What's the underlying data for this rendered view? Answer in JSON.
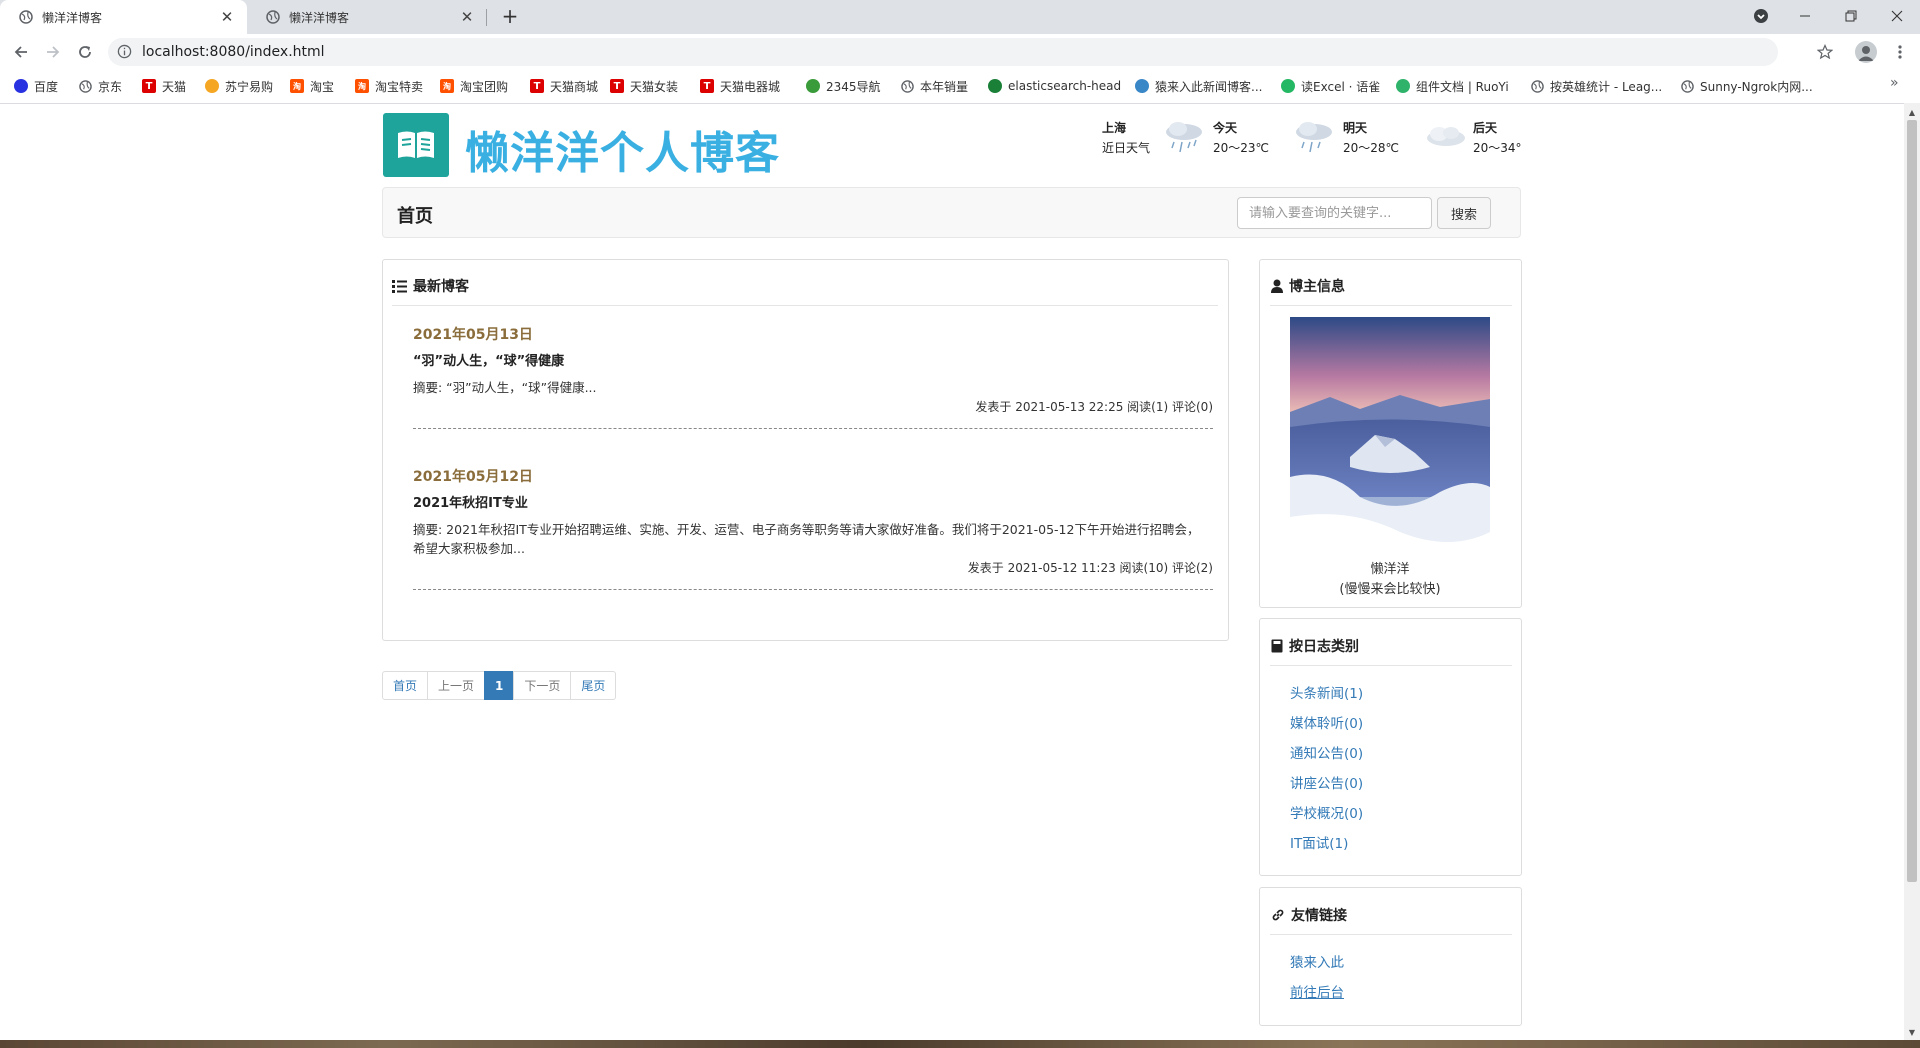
{
  "browser": {
    "tabs": [
      {
        "title": "懒洋洋博客",
        "active": true
      },
      {
        "title": "懒洋洋博客",
        "active": false
      }
    ],
    "close_glyph": "✕",
    "new_tab_glyph": "+",
    "url": "localhost:8080/index.html",
    "bookmarks": [
      {
        "label": "百度",
        "icon": "baidu-paw-icon",
        "color": "#2932e1"
      },
      {
        "label": "京东",
        "icon": "globe-icon",
        "color": "#5f6368"
      },
      {
        "label": "天猫",
        "icon": "tmall-icon",
        "color": "#d00"
      },
      {
        "label": "苏宁易购",
        "icon": "suning-icon",
        "color": "#f5a623"
      },
      {
        "label": "淘宝",
        "icon": "taobao-icon",
        "color": "#ff5000"
      },
      {
        "label": "淘宝特卖",
        "icon": "taobao-icon",
        "color": "#ff5000"
      },
      {
        "label": "淘宝团购",
        "icon": "taobao-icon",
        "color": "#ff5000"
      },
      {
        "label": "天猫商城",
        "icon": "tmall-icon",
        "color": "#d00"
      },
      {
        "label": "天猫女装",
        "icon": "tmall-icon",
        "color": "#d00"
      },
      {
        "label": "天猫电器城",
        "icon": "tmall-icon",
        "color": "#d00"
      },
      {
        "label": "2345导航",
        "icon": "2345-icon",
        "color": "#3a9b3a"
      },
      {
        "label": "本年销量",
        "icon": "globe-icon",
        "color": "#5f6368"
      },
      {
        "label": "elasticsearch-head",
        "icon": "elastic-icon",
        "color": "#1a7f37"
      },
      {
        "label": "猿来入此新闻博客...",
        "icon": "yuan-icon",
        "color": "#3a87c8"
      },
      {
        "label": "读Excel · 语雀",
        "icon": "yuque-icon",
        "color": "#25b864"
      },
      {
        "label": "组件文档 | RuoYi",
        "icon": "ruoyi-icon",
        "color": "#2fb36b"
      },
      {
        "label": "按英雄统计 - Leag...",
        "icon": "globe-icon",
        "color": "#5f6368"
      },
      {
        "label": "Sunny-Ngrok内网...",
        "icon": "globe-icon",
        "color": "#5f6368"
      }
    ],
    "more_glyph": "»"
  },
  "header": {
    "logo_title": "懒洋洋个人博客"
  },
  "weather": {
    "city": "上海",
    "subtitle": "近日天气",
    "days": [
      {
        "label": "今天",
        "temp": "20～23℃",
        "icon": "rain-cloud-icon"
      },
      {
        "label": "明天",
        "temp": "20～28℃",
        "icon": "rain-cloud-icon"
      },
      {
        "label": "后天",
        "temp": "20～34℃",
        "icon": "cloud-icon"
      }
    ]
  },
  "nav": {
    "home": "首页",
    "search_placeholder": "请输入要查询的关键字...",
    "search_button": "搜索"
  },
  "latest": {
    "title": "最新博客",
    "posts": [
      {
        "date": "2021年05月13日",
        "title": "“羽”动人生，“球”得健康",
        "summary": "摘要: “羽”动人生，“球”得健康...",
        "meta": "发表于 2021-05-13 22:25 阅读(1) 评论(0)"
      },
      {
        "date": "2021年05月12日",
        "title": "2021年秋招IT专业",
        "summary": "摘要: 2021年秋招IT专业开始招聘运维、实施、开发、运营、电子商务等职务等请大家做好准备。我们将于2021-05-12下午开始进行招聘会，希望大家积极参加...",
        "meta": "发表于 2021-05-12 11:23 阅读(10) 评论(2)"
      }
    ]
  },
  "pagination": {
    "first": "首页",
    "prev": "上一页",
    "current": "1",
    "next": "下一页",
    "last": "尾页"
  },
  "owner": {
    "title": "博主信息",
    "name": "懒洋洋",
    "motto": "(慢慢来会比较快)"
  },
  "categories": {
    "title": "按日志类别",
    "items": [
      "头条新闻(1)",
      "媒体聆听(0)",
      "通知公告(0)",
      "讲座公告(0)",
      "学校概况(0)",
      "IT面试(1)"
    ]
  },
  "friends": {
    "title": "友情链接",
    "items": [
      "猿来入此",
      "前往后台"
    ]
  },
  "colors": {
    "accent": "#337ab7",
    "logo_bg": "#1ea49a",
    "logo_text": "#3ab0e2",
    "date": "#8a6d3b"
  }
}
